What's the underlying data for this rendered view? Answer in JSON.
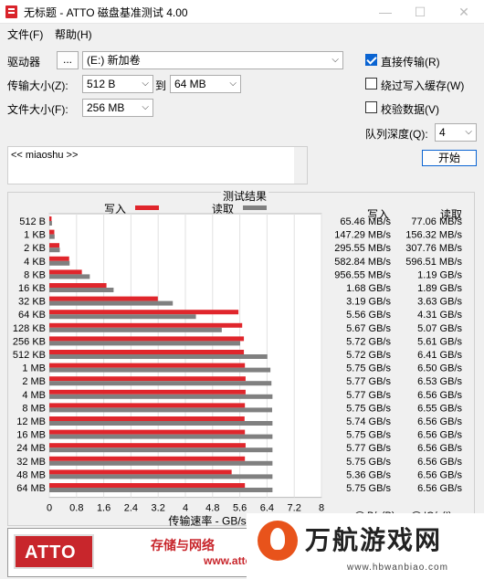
{
  "window": {
    "title": "无标题 - ATTO 磁盘基准测试 4.00",
    "minimize": "—",
    "maximize": "☐",
    "close": "✕"
  },
  "menu": {
    "file": "文件(F)",
    "help": "帮助(H)"
  },
  "controls": {
    "drive_label": "驱动器",
    "browse": "...",
    "drive_value": "(E:) 新加卷",
    "transfer_label": "传输大小(Z):",
    "transfer_from": "512 B",
    "to_label": "到",
    "transfer_to": "64 MB",
    "filesize_label": "文件大小(F):",
    "filesize_value": "256 MB",
    "direct_io": "直接传输(R)",
    "bypass_cache": "绕过写入缓存(W)",
    "verify": "校验数据(V)",
    "queue_label": "队列深度(Q):",
    "queue_value": "4",
    "start": "开始",
    "description": "<< miaoshu >>"
  },
  "results": {
    "header": "测试结果",
    "legend_write": "写入",
    "legend_read": "读取",
    "col_write": "写入",
    "col_read": "读取",
    "rows": [
      {
        "size": "512 B",
        "write": "65.46 MB/s",
        "read": "77.06 MB/s"
      },
      {
        "size": "1 KB",
        "write": "147.29 MB/s",
        "read": "156.32 MB/s"
      },
      {
        "size": "2 KB",
        "write": "295.55 MB/s",
        "read": "307.76 MB/s"
      },
      {
        "size": "4 KB",
        "write": "582.84 MB/s",
        "read": "596.51 MB/s"
      },
      {
        "size": "8 KB",
        "write": "956.55 MB/s",
        "read": "1.19 GB/s"
      },
      {
        "size": "16 KB",
        "write": "1.68 GB/s",
        "read": "1.89 GB/s"
      },
      {
        "size": "32 KB",
        "write": "3.19 GB/s",
        "read": "3.63 GB/s"
      },
      {
        "size": "64 KB",
        "write": "5.56 GB/s",
        "read": "4.31 GB/s"
      },
      {
        "size": "128 KB",
        "write": "5.67 GB/s",
        "read": "5.07 GB/s"
      },
      {
        "size": "256 KB",
        "write": "5.72 GB/s",
        "read": "5.61 GB/s"
      },
      {
        "size": "512 KB",
        "write": "5.72 GB/s",
        "read": "6.41 GB/s"
      },
      {
        "size": "1 MB",
        "write": "5.75 GB/s",
        "read": "6.50 GB/s"
      },
      {
        "size": "2 MB",
        "write": "5.77 GB/s",
        "read": "6.53 GB/s"
      },
      {
        "size": "4 MB",
        "write": "5.77 GB/s",
        "read": "6.56 GB/s"
      },
      {
        "size": "8 MB",
        "write": "5.75 GB/s",
        "read": "6.55 GB/s"
      },
      {
        "size": "12 MB",
        "write": "5.74 GB/s",
        "read": "6.56 GB/s"
      },
      {
        "size": "16 MB",
        "write": "5.75 GB/s",
        "read": "6.56 GB/s"
      },
      {
        "size": "24 MB",
        "write": "5.77 GB/s",
        "read": "6.56 GB/s"
      },
      {
        "size": "32 MB",
        "write": "5.75 GB/s",
        "read": "6.56 GB/s"
      },
      {
        "size": "48 MB",
        "write": "5.36 GB/s",
        "read": "6.56 GB/s"
      },
      {
        "size": "64 MB",
        "write": "5.75 GB/s",
        "read": "6.56 GB/s"
      }
    ],
    "units_bs": "B/s(B)",
    "units_ios": "IO/s(I)"
  },
  "chart_data": {
    "type": "bar",
    "orientation": "horizontal",
    "categories": [
      "512 B",
      "1 KB",
      "2 KB",
      "4 KB",
      "8 KB",
      "16 KB",
      "32 KB",
      "64 KB",
      "128 KB",
      "256 KB",
      "512 KB",
      "1 MB",
      "2 MB",
      "4 MB",
      "8 MB",
      "12 MB",
      "16 MB",
      "24 MB",
      "32 MB",
      "48 MB",
      "64 MB"
    ],
    "series": [
      {
        "name": "写入",
        "color": "#e0262c",
        "values": [
          0.065,
          0.147,
          0.296,
          0.583,
          0.957,
          1.68,
          3.19,
          5.56,
          5.67,
          5.72,
          5.72,
          5.75,
          5.77,
          5.77,
          5.75,
          5.74,
          5.75,
          5.77,
          5.75,
          5.36,
          5.75
        ]
      },
      {
        "name": "读取",
        "color": "#808080",
        "values": [
          0.077,
          0.156,
          0.308,
          0.597,
          1.19,
          1.89,
          3.63,
          4.31,
          5.07,
          5.61,
          6.41,
          6.5,
          6.53,
          6.56,
          6.55,
          6.56,
          6.56,
          6.56,
          6.56,
          6.56,
          6.56
        ]
      }
    ],
    "xticks": [
      "0",
      "0.8",
      "1.6",
      "2.4",
      "3.2",
      "4",
      "4.8",
      "5.6",
      "6.4",
      "7.2",
      "8"
    ],
    "xlim": [
      0,
      8
    ],
    "xlabel": "传输速率 - GB/s",
    "grid": true
  },
  "watermark": {
    "logo": "ATTO",
    "slogan": "存储与网络",
    "url": "www.atto",
    "site_title": "万航游戏网",
    "site_url": "www.hbwanbiao.com"
  },
  "colors": {
    "write": "#e0262c",
    "read": "#808080",
    "accent": "#0a64d2"
  }
}
